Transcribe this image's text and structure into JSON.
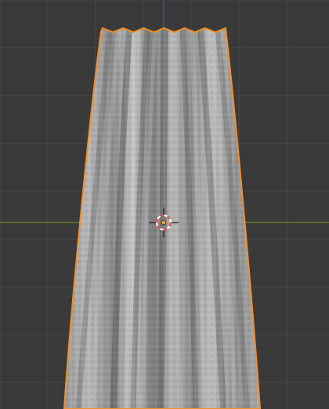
{
  "viewport": {
    "mode": "3d-viewport",
    "view": "front-orthographic",
    "background_color": "#393939",
    "grid_minor_color": "#414141",
    "grid_major_color": "#474747",
    "x_axis_color": "#6b8c2e",
    "z_axis_color": "#2f5d99"
  },
  "object": {
    "shape": "cloth-curtain",
    "selected": true,
    "selection_outline_color": "#f0902b",
    "base_color": "#a9a9a9"
  },
  "cursor_3d": {
    "icon": "3d-cursor-icon",
    "ring_colors": [
      "#e04040",
      "#ffffff"
    ]
  },
  "origin": {
    "color": "#f5a623"
  }
}
